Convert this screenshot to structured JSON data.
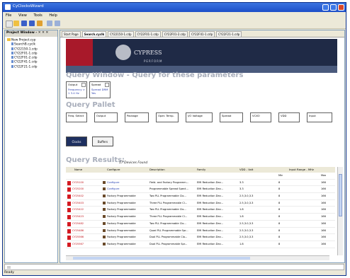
{
  "window": {
    "title": "CyClocksWizard"
  },
  "menu": [
    "File",
    "View",
    "Tools",
    "Help"
  ],
  "sidebar": {
    "title": "Project Window - ✕ ✕ ✕",
    "root": "New Project.cyp",
    "items": [
      "SearchB.cyclk",
      "CY22150-1.cdp",
      "CY22F01-1.cdp",
      "CY22F01-2.cdp",
      "CY22F41-1.cdp",
      "CY22F21-1.cdp"
    ]
  },
  "tabs": [
    "Start Page",
    "Search.cyclk",
    "CY22150-1.cdp",
    "CY22F01-1.cdp",
    "CY22F01-2.cdp",
    "CY22F41-1.cdp",
    "CY22F21-1.cdp"
  ],
  "banner": {
    "brand": "CYPRESS",
    "tagline": "PERFORM"
  },
  "query_window": {
    "heading": "Query Window - Query for these parameters",
    "chips": [
      {
        "label": "Output",
        "value": "Frequency > 1\n3.4 Hz"
      },
      {
        "label": "Spread",
        "value": "Spread DRM Yes"
      }
    ]
  },
  "query_pallet": {
    "heading": "Query Pallet",
    "items": [
      "Freq. Select",
      "Output",
      "Package",
      "Oper. Temp.",
      "I/O Voltage",
      "Spread",
      "VCXO",
      "VDD",
      "Input"
    ]
  },
  "buttons": {
    "clocks": "Clocks",
    "buffers": "Buffers"
  },
  "results": {
    "heading": "Query Results:",
    "found": "17 Devices Found",
    "columns": [
      "Name",
      "Configure",
      "Description",
      "Family",
      "VDD - Volt",
      "Input Range - MHz"
    ],
    "subcolumns": [
      "Min",
      "Max"
    ],
    "rows": [
      {
        "name": "CY25100",
        "configure": "Configure",
        "description": "Field- and Factory Programm...",
        "family": "EMI Reduction Dev...",
        "vdd": "3.3",
        "min": "8",
        "max": "166"
      },
      {
        "name": "CY25200",
        "configure": "Configure",
        "description": "Programmable Spread Spect...",
        "family": "EMI Reduction Dev...",
        "vdd": "3.3",
        "min": "8",
        "max": "166"
      },
      {
        "name": "CY25402",
        "configure": "Factory Programmable",
        "description": "Two PLL Programmable Clo...",
        "family": "EMI Reduction Dev...",
        "vdd": "2.5,3.0,3.3",
        "min": "8",
        "max": "166"
      },
      {
        "name": "CY25403",
        "configure": "Factory Programmable",
        "description": "Three PLL Programmable Cl...",
        "family": "EMI Reduction Dev...",
        "vdd": "2.5,3.0,3.3",
        "min": "8",
        "max": "166"
      },
      {
        "name": "CY25422",
        "configure": "Factory Programmable",
        "description": "Two PLL Programmable Clo...",
        "family": "EMI Reduction Dev...",
        "vdd": "1.8",
        "min": "8",
        "max": "166"
      },
      {
        "name": "CY25423",
        "configure": "Factory Programmable",
        "description": "Three PLL Programmable Cl...",
        "family": "EMI Reduction Dev...",
        "vdd": "1.8",
        "min": "8",
        "max": "166"
      },
      {
        "name": "CY25482",
        "configure": "Factory Programmable",
        "description": "Two PLL Programmable Clo...",
        "family": "EMI Reduction Dev...",
        "vdd": "2.5,3.0,3.3",
        "min": "8",
        "max": "166"
      },
      {
        "name": "CY25486",
        "configure": "Factory Programmable",
        "description": "Quad PLL Programmable Spr...",
        "family": "EMI Reduction Dev...",
        "vdd": "2.5,3.0,3.3",
        "min": "8",
        "max": "166"
      },
      {
        "name": "CY25566",
        "configure": "Factory Programmable",
        "description": "Dual PLL Programmable Clo...",
        "family": "EMI Reduction Dev...",
        "vdd": "2.5,3.0,3.3",
        "min": "8",
        "max": "166"
      },
      {
        "name": "CY25567",
        "configure": "Factory Programmable",
        "description": "Dual PLL Programmable Spr...",
        "family": "EMI Reduction Dev...",
        "vdd": "1.8",
        "min": "8",
        "max": "166"
      }
    ]
  },
  "status": "Ready"
}
